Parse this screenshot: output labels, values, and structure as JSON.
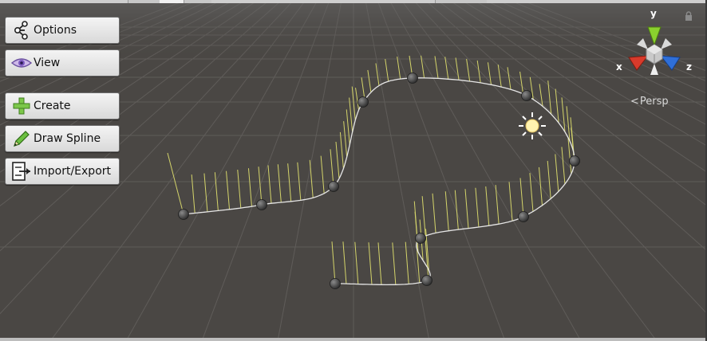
{
  "toolbar": {
    "options_label": "Options",
    "view_label": "View",
    "create_label": "Create",
    "draw_spline_label": "Draw Spline",
    "import_export_label": "Import/Export"
  },
  "gizmo": {
    "y_label": "y",
    "x_label": "x",
    "z_label": "z",
    "projection_label": "Persp",
    "colors": {
      "x": "#d83a2b",
      "y": "#8ad12e",
      "z": "#2f6fd8"
    }
  },
  "icons": {
    "options": "share-nodes-icon",
    "view": "eye-icon",
    "create": "plus-icon",
    "draw_spline": "pencil-icon",
    "import_export": "import-export-icon",
    "light": "directional-light-icon",
    "lock": "lock-icon"
  },
  "colors": {
    "viewport_background": "#4a4744",
    "grid": "#6a6663",
    "spline": "#e8e8e8",
    "normals": "#d8d86a",
    "control_points": "#3a3a3a"
  }
}
